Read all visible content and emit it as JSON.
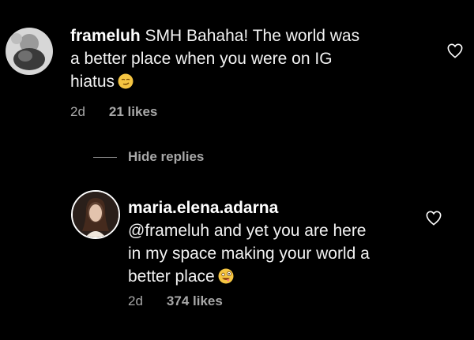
{
  "comment": {
    "username": "frameluh",
    "text": "SMH Bahaha! The world was a better place when you were on IG hiatus",
    "line1": "SMH Bahaha! The world was",
    "line2": "a better place when you were on IG",
    "line3": "hiatus",
    "emoji": "smirking-face",
    "time": "2d",
    "likes": "21 likes"
  },
  "hide_replies_label": "Hide replies",
  "reply": {
    "username": "maria.elena.adarna",
    "line1": "@frameluh and yet you are here",
    "line2": "in my space making your world a",
    "line3": "better place",
    "emoji": "zany-face",
    "time": "2d",
    "likes": "374 likes"
  },
  "colors": {
    "background": "#000000",
    "text": "#f2f2f2",
    "muted": "#a8a8a8",
    "avatar_ring": "#ffffff"
  }
}
